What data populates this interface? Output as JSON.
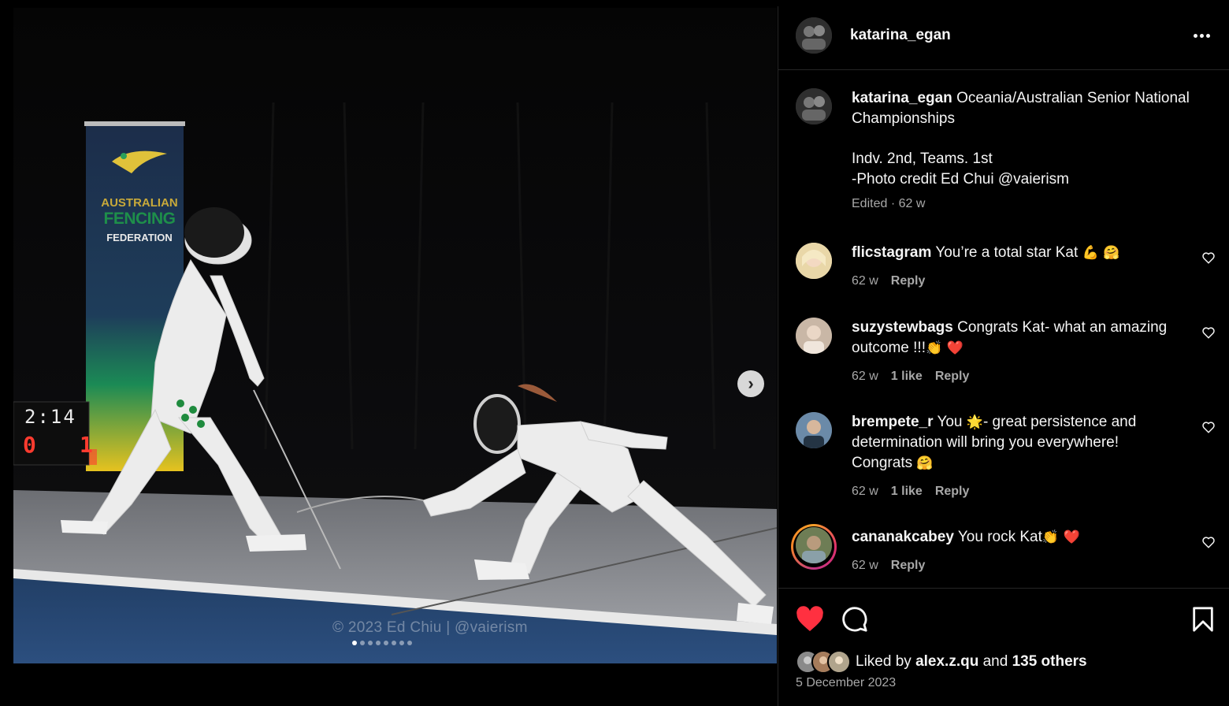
{
  "post": {
    "username": "katarina_egan",
    "caption_lines": [
      "Oceania/Australian Senior National Championships",
      "Indv. 2nd, Teams. 1st",
      "-Photo credit Ed Chui @vaierism"
    ],
    "caption_meta": "Edited · 62 w",
    "more_icon": "more-horizontal-icon"
  },
  "media": {
    "watermark": "© 2023 Ed Chiu  |  @vaierism",
    "banner": [
      "AUSTRALIAN",
      "FENCING",
      "FEDERATION"
    ],
    "scoreboard_time": "2:14",
    "scoreboard_left": "0",
    "scoreboard_right": "1",
    "carousel_count": 8,
    "carousel_active": 1,
    "next_icon": "chevron-right-icon"
  },
  "comments": [
    {
      "username": "flicstagram",
      "text": "You’re a total star Kat",
      "emoji": "💪 🤗",
      "age": "62 w",
      "likes": "",
      "reply": "Reply"
    },
    {
      "username": "suzystewbags",
      "text": "Congrats Kat- what an amazing outcome !!!",
      "emoji": "👏 ❤️",
      "age": "62 w",
      "likes": "1 like",
      "reply": "Reply"
    },
    {
      "username": "brempete_r",
      "text": "You",
      "emoji_mid": "🌟",
      "text2": "- great persistence and determination will bring you everywhere! Congrats",
      "emoji": "🤗",
      "age": "62 w",
      "likes": "1 like",
      "reply": "Reply"
    },
    {
      "username": "cananakcabey",
      "text": "You rock Kat",
      "emoji": "👏 ❤️",
      "age": "62 w",
      "likes": "",
      "reply": "Reply"
    }
  ],
  "actions": {
    "like_icon": "heart-filled-icon",
    "like_color": "#ff3040",
    "comment_icon": "comment-icon",
    "save_icon": "bookmark-icon",
    "liked_by_prefix": "Liked by",
    "liked_by_user": "alex.z.qu",
    "liked_by_and": "and",
    "liked_by_others": "135 others",
    "date": "5 December 2023"
  }
}
